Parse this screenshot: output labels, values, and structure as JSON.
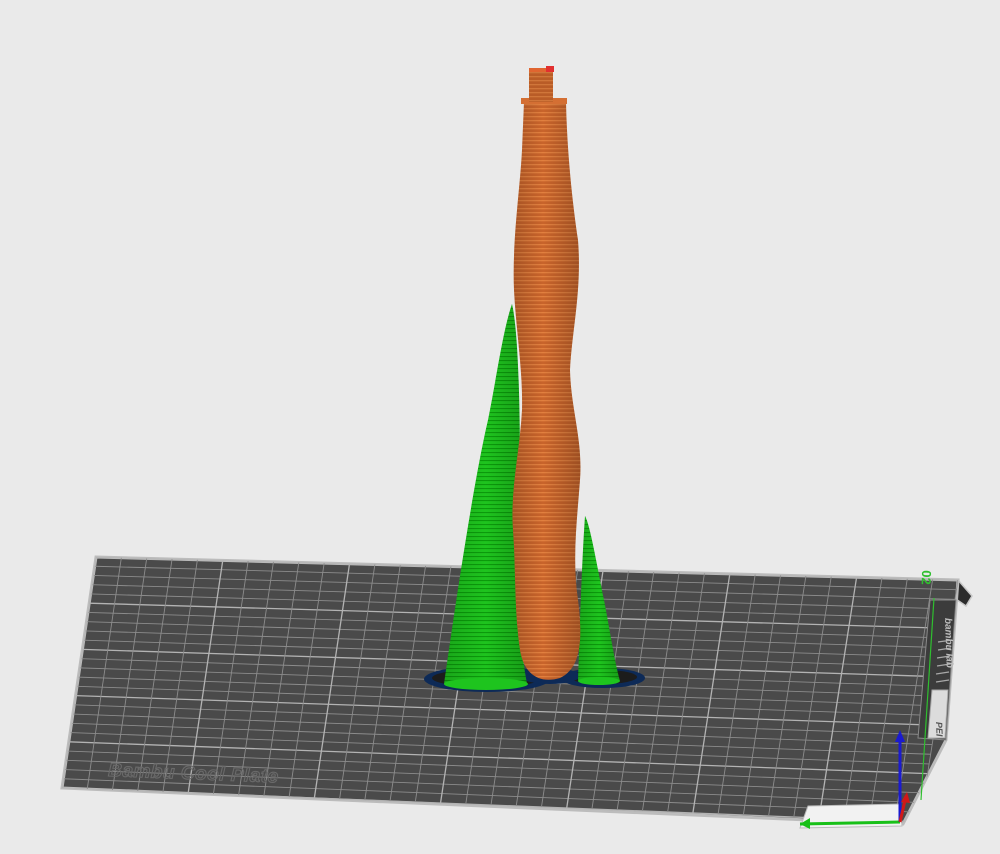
{
  "viewport": {
    "plate_name": "Bambu Cool Plate",
    "plate_number": "02",
    "plate_side_text": "bambu lab",
    "plate_corner_text": "PEI"
  },
  "colors": {
    "background": "#eaeaea",
    "plate_fill": "#4a4a4a",
    "plate_border": "#b8b8b8",
    "grid_line": "#8e8e8e",
    "grid_major": "#b5b5b5",
    "orange_model": "#c9642b",
    "orange_stripe": "#e07a3a",
    "green_support": "#1cc21c",
    "green_stripe": "#0a9a0a",
    "support_base": "#0d2a57",
    "axis_x": "#18c018",
    "axis_y": "#1a1ad0",
    "axis_z": "#d01818"
  },
  "objects": [
    {
      "name": "main-model",
      "kind": "model",
      "color_key": "orange_model"
    },
    {
      "name": "left-support-cone",
      "kind": "support",
      "color_key": "green_support"
    },
    {
      "name": "right-support-cone",
      "kind": "support",
      "color_key": "green_support"
    }
  ],
  "icons": {
    "axis_gizmo": "axis-gizmo-icon",
    "plate_handle": "plate-handle-icon"
  }
}
